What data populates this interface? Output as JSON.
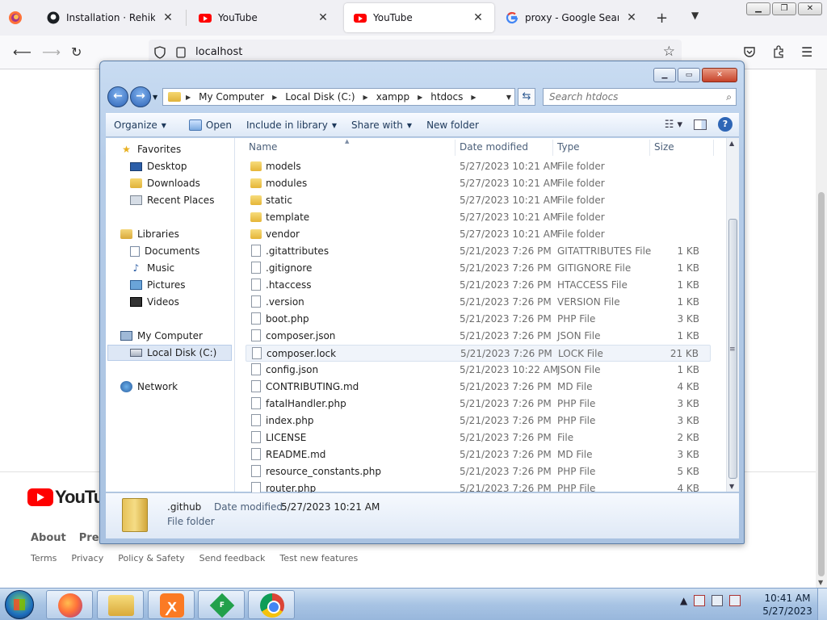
{
  "browser": {
    "tabs": [
      {
        "title": "Installation · Rehike/Rehike",
        "icon": "github-icon",
        "active": false
      },
      {
        "title": "YouTube",
        "icon": "youtube-icon",
        "active": false
      },
      {
        "title": "YouTube",
        "icon": "youtube-icon",
        "active": true
      },
      {
        "title": "proxy - Google Search",
        "icon": "google-icon",
        "active": false
      }
    ],
    "url": "localhost"
  },
  "youtube_page": {
    "logo_text": "YouTube",
    "footer_primary": [
      "About",
      "Press"
    ],
    "footer_secondary": [
      "Terms",
      "Privacy",
      "Policy & Safety",
      "Send feedback",
      "Test new features"
    ]
  },
  "explorer": {
    "breadcrumb": [
      "My Computer",
      "Local Disk (C:)",
      "xampp",
      "htdocs"
    ],
    "search_placeholder": "Search htdocs",
    "commands": {
      "organize": "Organize",
      "open": "Open",
      "include": "Include in library",
      "share": "Share with",
      "newfolder": "New folder"
    },
    "nav": {
      "favorites": "Favorites",
      "desktop": "Desktop",
      "downloads": "Downloads",
      "recent": "Recent Places",
      "libraries": "Libraries",
      "documents": "Documents",
      "music": "Music",
      "pictures": "Pictures",
      "videos": "Videos",
      "computer": "My Computer",
      "localdisk": "Local Disk (C:)",
      "network": "Network"
    },
    "columns": {
      "name": "Name",
      "date": "Date modified",
      "type": "Type",
      "size": "Size"
    },
    "files": [
      {
        "name": "models",
        "date": "5/27/2023 10:21 AM",
        "type": "File folder",
        "size": "",
        "kind": "folder"
      },
      {
        "name": "modules",
        "date": "5/27/2023 10:21 AM",
        "type": "File folder",
        "size": "",
        "kind": "folder"
      },
      {
        "name": "static",
        "date": "5/27/2023 10:21 AM",
        "type": "File folder",
        "size": "",
        "kind": "folder"
      },
      {
        "name": "template",
        "date": "5/27/2023 10:21 AM",
        "type": "File folder",
        "size": "",
        "kind": "folder"
      },
      {
        "name": "vendor",
        "date": "5/27/2023 10:21 AM",
        "type": "File folder",
        "size": "",
        "kind": "folder"
      },
      {
        "name": ".gitattributes",
        "date": "5/21/2023 7:26 PM",
        "type": "GITATTRIBUTES File",
        "size": "1 KB",
        "kind": "file"
      },
      {
        "name": ".gitignore",
        "date": "5/21/2023 7:26 PM",
        "type": "GITIGNORE File",
        "size": "1 KB",
        "kind": "file"
      },
      {
        "name": ".htaccess",
        "date": "5/21/2023 7:26 PM",
        "type": "HTACCESS File",
        "size": "1 KB",
        "kind": "file"
      },
      {
        "name": ".version",
        "date": "5/21/2023 7:26 PM",
        "type": "VERSION File",
        "size": "1 KB",
        "kind": "file"
      },
      {
        "name": "boot.php",
        "date": "5/21/2023 7:26 PM",
        "type": "PHP File",
        "size": "3 KB",
        "kind": "file"
      },
      {
        "name": "composer.json",
        "date": "5/21/2023 7:26 PM",
        "type": "JSON File",
        "size": "1 KB",
        "kind": "file"
      },
      {
        "name": "composer.lock",
        "date": "5/21/2023 7:26 PM",
        "type": "LOCK File",
        "size": "21 KB",
        "kind": "file",
        "hover": true
      },
      {
        "name": "config.json",
        "date": "5/21/2023 10:22 AM",
        "type": "JSON File",
        "size": "1 KB",
        "kind": "file"
      },
      {
        "name": "CONTRIBUTING.md",
        "date": "5/21/2023 7:26 PM",
        "type": "MD File",
        "size": "4 KB",
        "kind": "file"
      },
      {
        "name": "fatalHandler.php",
        "date": "5/21/2023 7:26 PM",
        "type": "PHP File",
        "size": "3 KB",
        "kind": "file"
      },
      {
        "name": "index.php",
        "date": "5/21/2023 7:26 PM",
        "type": "PHP File",
        "size": "3 KB",
        "kind": "file"
      },
      {
        "name": "LICENSE",
        "date": "5/21/2023 7:26 PM",
        "type": "File",
        "size": "2 KB",
        "kind": "file"
      },
      {
        "name": "README.md",
        "date": "5/21/2023 7:26 PM",
        "type": "MD File",
        "size": "3 KB",
        "kind": "file"
      },
      {
        "name": "resource_constants.php",
        "date": "5/21/2023 7:26 PM",
        "type": "PHP File",
        "size": "5 KB",
        "kind": "file"
      },
      {
        "name": "router.php",
        "date": "5/21/2023 7:26 PM",
        "type": "PHP File",
        "size": "4 KB",
        "kind": "file"
      }
    ],
    "details": {
      "name": ".github",
      "type": "File folder",
      "modified_label": "Date modified:",
      "modified_value": "5/27/2023 10:21 AM"
    }
  },
  "taskbar": {
    "clock_time": "10:41 AM",
    "clock_date": "5/27/2023",
    "fz_label": "F"
  }
}
